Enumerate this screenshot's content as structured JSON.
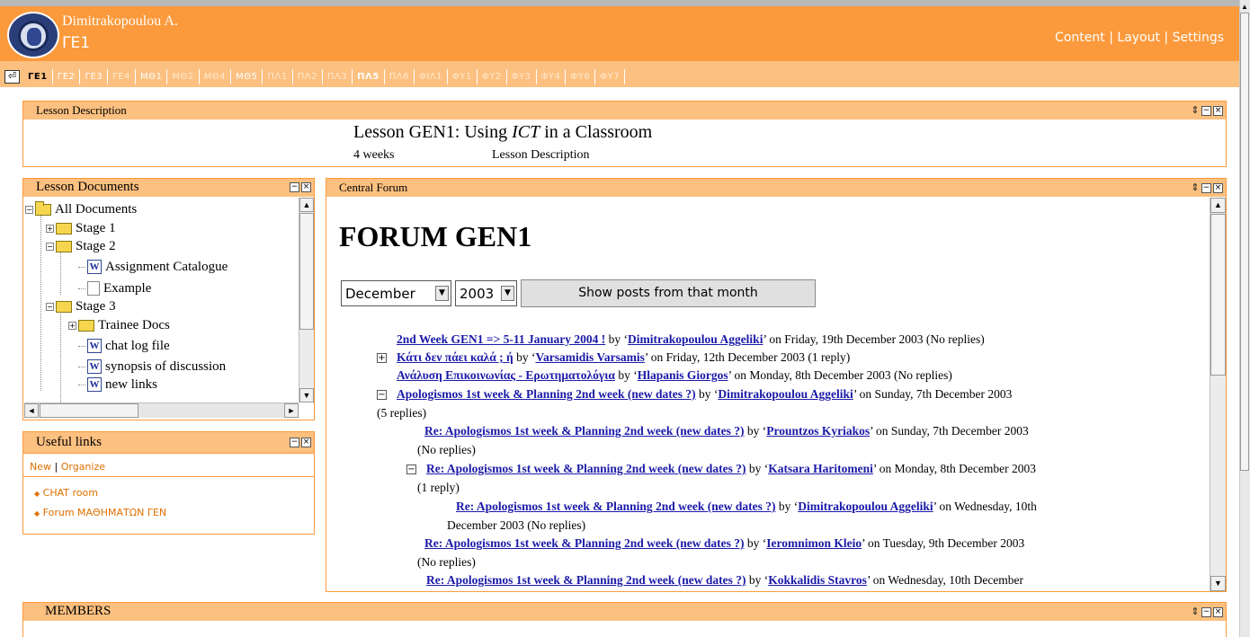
{
  "header": {
    "user_name": "Dimitrakopoulou A.",
    "class_name": "ΓΕ1",
    "links": [
      "Content",
      "Layout",
      "Settings"
    ],
    "separator": "|"
  },
  "tabs": [
    {
      "label": "ΓΕ1",
      "state": "active"
    },
    {
      "label": "ΓΕ2",
      "state": "normal"
    },
    {
      "label": "ΓΕ3",
      "state": "normal"
    },
    {
      "label": "ΓΕ4",
      "state": "dim"
    },
    {
      "label": "ΜΘ1",
      "state": "normal"
    },
    {
      "label": "ΜΘ2",
      "state": "dim"
    },
    {
      "label": "ΜΘ4",
      "state": "dim"
    },
    {
      "label": "ΜΘ5",
      "state": "normal"
    },
    {
      "label": "ΠΛ1",
      "state": "dim"
    },
    {
      "label": "ΠΛ2",
      "state": "dim"
    },
    {
      "label": "ΠΛ3",
      "state": "dim"
    },
    {
      "label": "ΠΛ5",
      "state": "highlight"
    },
    {
      "label": "ΠΛ6",
      "state": "dim"
    },
    {
      "label": "ΦΙΛ1",
      "state": "dim"
    },
    {
      "label": "ΦΥ1",
      "state": "dim"
    },
    {
      "label": "ΦΥ2",
      "state": "dim"
    },
    {
      "label": "ΦΥ3",
      "state": "dim"
    },
    {
      "label": "ΦΥ4",
      "state": "dim"
    },
    {
      "label": "ΦΥ6",
      "state": "dim"
    },
    {
      "label": "ΦΥ7",
      "state": "dim"
    }
  ],
  "lesson_description": {
    "panel_title": "Lesson Description",
    "title_prefix": "Lesson GEN1: Using ",
    "title_em": "ICT",
    "title_suffix": " in a Classroom",
    "weeks": "4 weeks",
    "description_link": "Lesson Description"
  },
  "lesson_documents": {
    "panel_title": "Lesson Documents",
    "tree": [
      {
        "label": "All Documents",
        "type": "folder",
        "level": 0,
        "expander": "−"
      },
      {
        "label": "Stage 1",
        "type": "folder",
        "level": 1,
        "expander": "+"
      },
      {
        "label": "Stage 2",
        "type": "folder",
        "level": 1,
        "expander": "−"
      },
      {
        "label": "Assignment Catalogue",
        "type": "word",
        "level": 2
      },
      {
        "label": "Example",
        "type": "blank",
        "level": 2
      },
      {
        "label": "Stage 3",
        "type": "folder",
        "level": 1,
        "expander": "−"
      },
      {
        "label": "Trainee Docs",
        "type": "folder",
        "level": 2,
        "expander": "+"
      },
      {
        "label": "chat log file",
        "type": "word",
        "level": 2
      },
      {
        "label": "synopsis of discussion",
        "type": "word",
        "level": 2
      },
      {
        "label": "new links",
        "type": "word",
        "level": 2
      }
    ]
  },
  "useful_links": {
    "panel_title": "Useful links",
    "actions": [
      "New",
      "Organize"
    ],
    "links": [
      "CHAT room",
      "Forum ΜΑΘΗΜΑΤΩΝ ΓΕΝ"
    ]
  },
  "central_forum": {
    "panel_title": "Central Forum",
    "heading": "FORUM GEN1",
    "month_value": "December",
    "year_value": "2003",
    "show_button": "Show posts from that month",
    "posts": [
      {
        "title": "2nd Week GEN1 => 5-11 January 2004 !",
        "by": " by ‘",
        "author": "Dimitrakopoulou Aggeliki",
        "tail": "’ on Friday, 19th December 2003 (No replies)"
      },
      {
        "title": "Κάτι δεν πάει καλά ; ή",
        "by": " by ‘",
        "author": "Varsamidis Varsamis",
        "tail": "’ on Friday, 12th December 2003 (1 reply)"
      },
      {
        "title": "Ανάλυση Επικοινωνίας - Ερωτηματολόγια",
        "by": " by ‘",
        "author": "Hlapanis Giorgos",
        "tail": "’ on Monday, 8th December 2003 (No replies)"
      },
      {
        "title": "Apologismos 1st week & Planning 2nd week (new dates ?)",
        "by": " by ‘",
        "author": "Dimitrakopoulou Aggeliki",
        "tail": "’ on Sunday, 7th December 2003",
        "wrap": "(5 replies)"
      },
      {
        "title": "Re: Apologismos 1st week & Planning 2nd week (new dates ?)",
        "by": " by ‘",
        "author": "Prountzos Kyriakos",
        "tail": "’ on Sunday, 7th December 2003",
        "wrap": "(No replies)"
      },
      {
        "title": "Re: Apologismos 1st week & Planning 2nd week (new dates ?)",
        "by": " by ‘",
        "author": "Katsara Haritomeni",
        "tail": "’ on Monday, 8th December 2003",
        "wrap": "(1 reply)"
      },
      {
        "title": "Re: Apologismos 1st week & Planning 2nd week (new dates ?)",
        "by": " by ‘",
        "author": "Dimitrakopoulou Aggeliki",
        "tail": "’ on Wednesday, 10th",
        "wrap": "December 2003 (No replies)"
      },
      {
        "title": "Re: Apologismos 1st week & Planning 2nd week (new dates ?)",
        "by": " by ‘",
        "author": "Ieromnimon Kleio",
        "tail": "’ on Tuesday, 9th December 2003",
        "wrap": "(No replies)"
      },
      {
        "title": "Re: Apologismos 1st week & Planning 2nd week (new dates ?)",
        "by": " by ‘",
        "author": "Kokkalidis Stavros",
        "tail": "’ on Wednesday, 10th December"
      }
    ]
  },
  "members": {
    "panel_title": "MEMBERS"
  },
  "icons": {
    "minimize": "−",
    "close": "×",
    "move": "⇕",
    "expand": "+",
    "collapse": "−",
    "scroll_up": "▲",
    "scroll_down": "▼",
    "scroll_left": "◄",
    "scroll_right": "►",
    "select_arrow": "▼",
    "home": "⏎",
    "bullet": "◆"
  },
  "colors": {
    "accent": "#fb9a3c",
    "header_light": "#fcc080",
    "link": "#1a1aa8",
    "links_orange": "#e07000"
  }
}
